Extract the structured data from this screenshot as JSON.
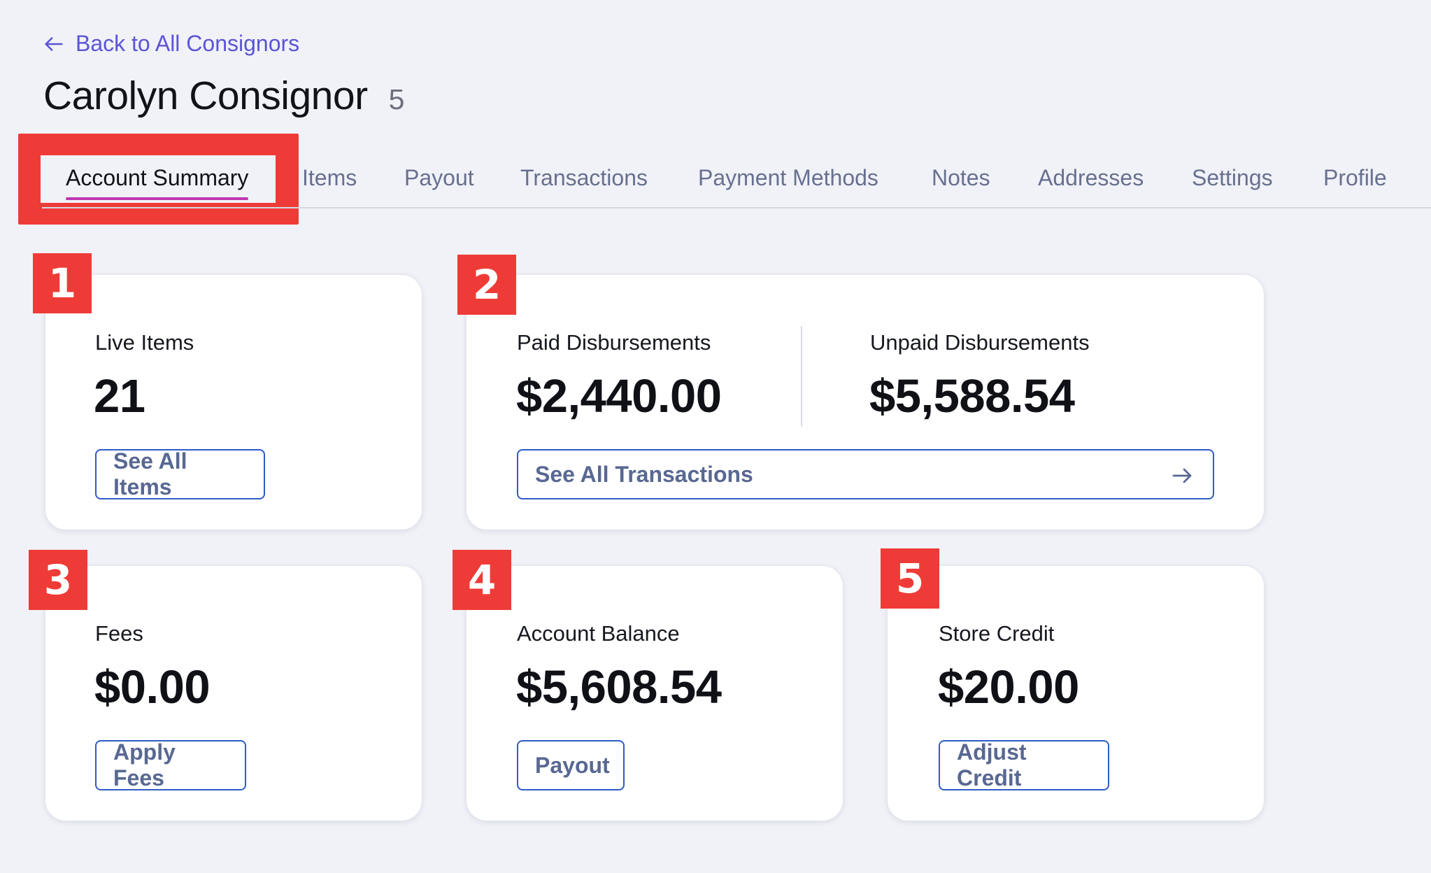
{
  "back_link": {
    "label": "Back to All Consignors"
  },
  "header": {
    "title": "Carolyn Consignor",
    "count": "5"
  },
  "tabs": [
    {
      "label": "Account Summary",
      "active": true
    },
    {
      "label": "Items"
    },
    {
      "label": "Payout"
    },
    {
      "label": "Transactions"
    },
    {
      "label": "Payment Methods"
    },
    {
      "label": "Notes"
    },
    {
      "label": "Addresses"
    },
    {
      "label": "Settings"
    },
    {
      "label": "Profile"
    }
  ],
  "badges": [
    "1",
    "2",
    "3",
    "4",
    "5"
  ],
  "cards": {
    "live_items": {
      "label": "Live Items",
      "value": "21",
      "button": "See All Items"
    },
    "disbursements": {
      "paid_label": "Paid Disbursements",
      "paid_value": "$2,440.00",
      "unpaid_label": "Unpaid Disbursements",
      "unpaid_value": "$5,588.54",
      "button": "See All Transactions"
    },
    "fees": {
      "label": "Fees",
      "value": "$0.00",
      "button": "Apply Fees"
    },
    "account_balance": {
      "label": "Account Balance",
      "value": "$5,608.54",
      "button": "Payout"
    },
    "store_credit": {
      "label": "Store Credit",
      "value": "$20.00",
      "button": "Adjust Credit"
    }
  },
  "colors": {
    "accent": "#5b55d6",
    "annotation_red": "#ef3b37",
    "button_border": "#2e5bc6",
    "tab_active_underline": "#c036b0",
    "background": "#f1f2f8"
  }
}
